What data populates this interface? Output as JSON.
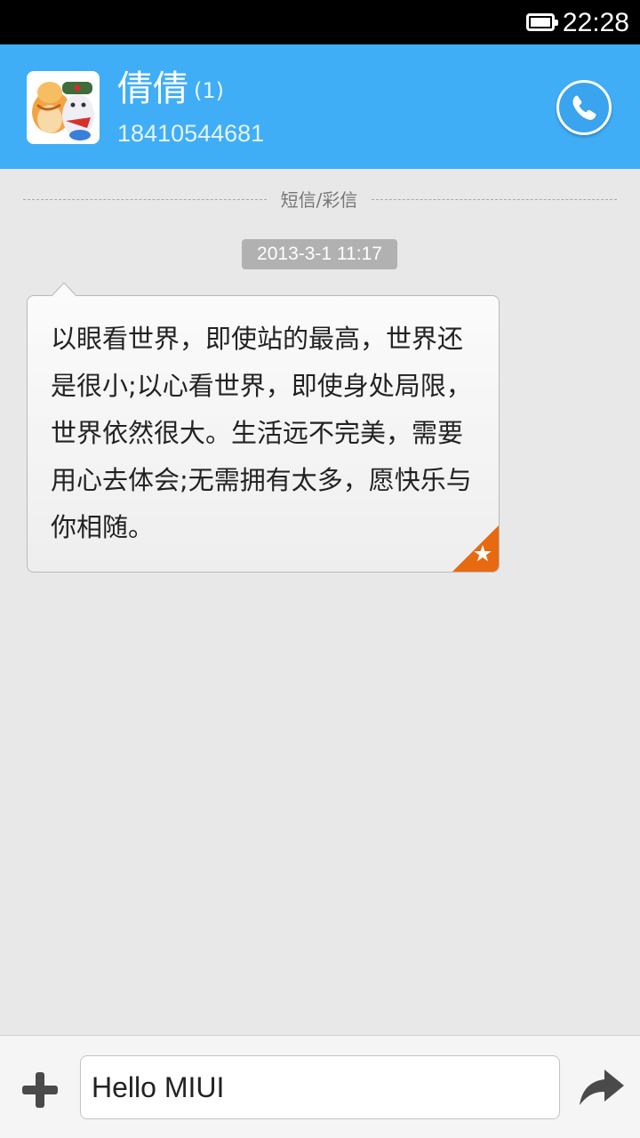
{
  "status_bar": {
    "time": "22:28",
    "battery_icon": "battery-full-icon"
  },
  "header": {
    "contact_name": "倩倩",
    "message_count": "(1)",
    "phone_number": "18410544681",
    "call_icon": "phone-icon",
    "background_color": "#40aef6"
  },
  "thread": {
    "divider_label": "短信/彩信",
    "timestamp": "2013-3-1 11:17",
    "messages": [
      {
        "text": "以眼看世界，即使站的最高，世界还是很小;以心看世界，即使身处局限，世界依然很大。生活远不完美，需要用心去体会;无需拥有太多，愿快乐与你相随。",
        "starred": true,
        "star_color": "#e86a10"
      }
    ]
  },
  "composer": {
    "attach_icon": "plus-icon",
    "input_value": "Hello MIUI",
    "send_icon": "send-arrow-icon"
  }
}
